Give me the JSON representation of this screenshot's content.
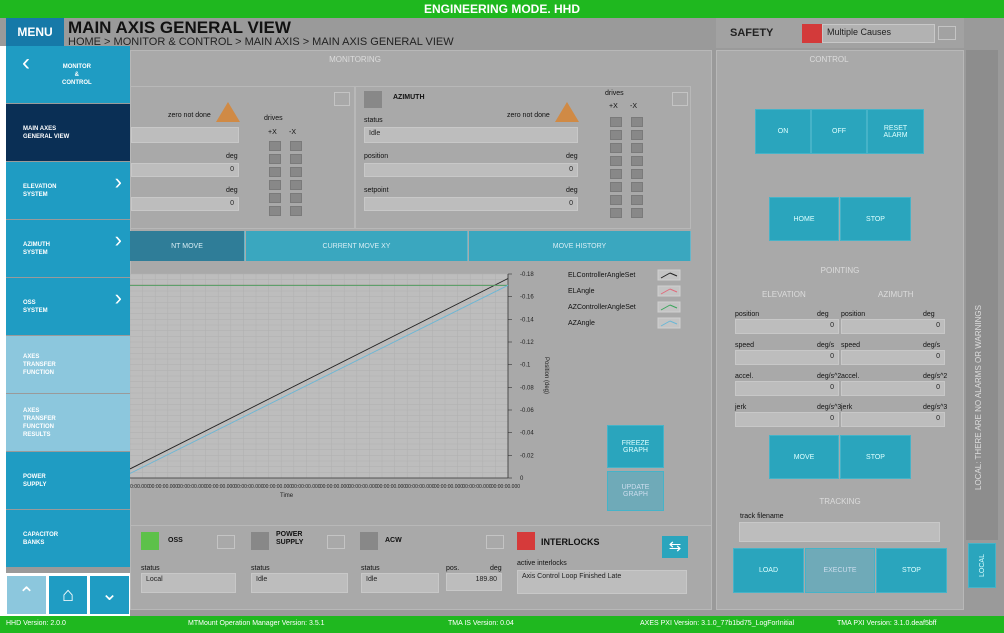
{
  "topbar": {
    "title": "ENGINEERING MODE. HHD"
  },
  "header": {
    "menu_label": "MENU",
    "title": "MAIN AXIS GENERAL VIEW",
    "breadcrumb": "HOME > MONITOR & CONTROL > MAIN AXIS > MAIN AXIS GENERAL VIEW"
  },
  "safety": {
    "label": "SAFETY",
    "cause": "Multiple Causes"
  },
  "sidebar": {
    "back_label_1": "MONITOR",
    "back_label_2": "&",
    "back_label_3": "CONTROL",
    "items": [
      {
        "l1": "MAIN AXES",
        "l2": "GENERAL VIEW",
        "l3": "",
        "l4": ""
      },
      {
        "l1": "ELEVATION",
        "l2": "SYSTEM",
        "l3": "",
        "l4": ""
      },
      {
        "l1": "AZIMUTH",
        "l2": "SYSTEM",
        "l3": "",
        "l4": ""
      },
      {
        "l1": "OSS",
        "l2": "SYSTEM",
        "l3": "",
        "l4": ""
      },
      {
        "l1": "AXES",
        "l2": "TRANSFER",
        "l3": "FUNCTION",
        "l4": ""
      },
      {
        "l1": "AXES",
        "l2": "TRANSFER",
        "l3": "FUNCTION",
        "l4": "RESULTS"
      },
      {
        "l1": "POWER",
        "l2": "SUPPLY",
        "l3": "",
        "l4": ""
      },
      {
        "l1": "CAPACITOR",
        "l2": "BANKS",
        "l3": "",
        "l4": ""
      }
    ]
  },
  "monitoring": {
    "title": "MONITORING",
    "elevation": {
      "zero_label": "zero not done",
      "drives_label": "drives",
      "plus_x": "+X",
      "minus_x": "-X",
      "unit1": "deg",
      "value1": "0",
      "unit2": "deg",
      "value2": "0"
    },
    "azimuth": {
      "title": "AZIMUTH",
      "status_label": "status",
      "status_value": "Idle",
      "zero_label": "zero not done",
      "position_label": "position",
      "position_unit": "deg",
      "position_value": "0",
      "setpoint_label": "setpoint",
      "setpoint_unit": "deg",
      "setpoint_value": "0",
      "drives_label": "drives",
      "plus_x": "+X",
      "minus_x": "-X"
    }
  },
  "tabs": [
    "NT MOVE",
    "CURRENT MOVE XY",
    "MOVE HISTORY"
  ],
  "graph": {
    "freeze_label_1": "FREEZE",
    "freeze_label_2": "GRAPH",
    "update_label_1": "UPDATE",
    "update_label_2": "GRAPH",
    "x_axis_label": "Time",
    "y_axis_label": "Position (deg)",
    "x_tick_label": "00:00:00.000"
  },
  "chart_data": {
    "type": "line",
    "xlabel": "Time",
    "ylabel": "Position (deg)",
    "ylim": [
      0,
      0.18
    ],
    "y_ticks": [
      "-0.18",
      "-0.16",
      "-0.14",
      "-0.12",
      "-0.1",
      "-0.08",
      "-0.06",
      "-0.04",
      "-0.02",
      "0"
    ],
    "x_ticks": [
      "00:00:00.000",
      "00:00:00.000",
      "00:00:00.000",
      "00:00:00.000",
      "00:00:00.000",
      "00:00:00.000",
      "00:00:00.000",
      "00:00:00.000",
      "00:00:00.000",
      "00:00:00.000",
      "00:00:00.000",
      "00:00:00.000",
      "00:00:00.000",
      "00:00:00.000"
    ],
    "series": [
      {
        "name": "ELControllerAngleSet",
        "color": "#222222",
        "points": [
          [
            0,
            0.008
          ],
          [
            1,
            0.176
          ]
        ]
      },
      {
        "name": "ELAngle",
        "color": "#e06b7b",
        "points": [
          [
            0,
            0.17
          ],
          [
            1,
            0.17
          ]
        ]
      },
      {
        "name": "AZControllerAngleSet",
        "color": "#3aa55c",
        "points": [
          [
            0,
            0.17
          ],
          [
            1,
            0.17
          ]
        ]
      },
      {
        "name": "AZAngle",
        "color": "#6ab7d6",
        "points": [
          [
            0,
            0.004
          ],
          [
            1,
            0.17
          ]
        ]
      }
    ],
    "grid": true,
    "legend": "right"
  },
  "bottom_panels": {
    "oss": {
      "title": "OSS",
      "status_label": "status",
      "status_value": "Local",
      "color": "#5dc14a"
    },
    "power_supply": {
      "title_1": "POWER",
      "title_2": "SUPPLY",
      "status_label": "status",
      "status_value": "Idle"
    },
    "acw": {
      "title": "ACW",
      "status_label": "status",
      "status_value": "Idle",
      "pos_label": "pos.",
      "deg_label": "deg",
      "pos_value": "189.80"
    },
    "interlocks": {
      "title": "INTERLOCKS",
      "active_label": "active interlocks",
      "active_value": "Axis Control Loop Finished Late",
      "color": "#d63a3a"
    }
  },
  "control": {
    "title": "CONTROL",
    "on": "ON",
    "off": "OFF",
    "reset_1": "RESET",
    "reset_2": "ALARM",
    "home": "HOME",
    "stop1": "STOP",
    "pointing": "POINTING",
    "elevation": "ELEVATION",
    "azimuth": "AZIMUTH",
    "fields": [
      {
        "label": "position",
        "unit": "deg",
        "value": "0"
      },
      {
        "label": "speed",
        "unit": "deg/s",
        "value": "0"
      },
      {
        "label": "accel.",
        "unit": "deg/s^2",
        "value": "0"
      },
      {
        "label": "jerk",
        "unit": "deg/s^3",
        "value": "0"
      }
    ],
    "move": "MOVE",
    "stop2": "STOP",
    "tracking": "TRACKING",
    "track_filename": "track filename",
    "load": "LOAD",
    "execute": "EXECUTE",
    "stop3": "STOP"
  },
  "alarms": {
    "text": "LOCAL: THERE ARE NO ALARMS OR WARNINGS",
    "local_label": "LOCAL"
  },
  "footer": {
    "hhd": "HHD Version:  2.0.0",
    "mtmount": "MTMount Operation Manager Version:  3.5.1",
    "tmais": "TMA IS Version:  0.04",
    "axes_pxi": "AXES PXI Version:  3.1.0_77b1bd75_LogForInitial",
    "tma_pxi": "TMA PXI Version:  3.1.0.deaf5bff"
  }
}
